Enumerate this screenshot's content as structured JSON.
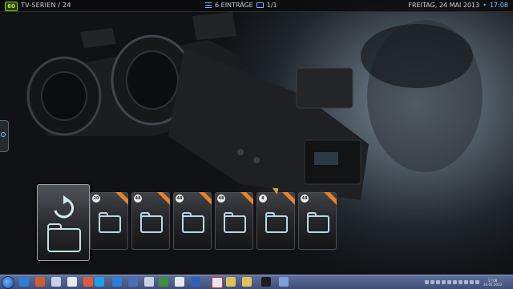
{
  "header": {
    "logo_text": "60",
    "breadcrumb": "TV-SERIEN / 24",
    "items_count": "6 EINTRÄGE",
    "page": "1/1",
    "date": "FREITAG, 24 MAI 2013",
    "separator": "•",
    "time": "17:08"
  },
  "tiles": [
    {
      "badge": "20",
      "ribbon": true
    },
    {
      "badge": "48",
      "ribbon": true
    },
    {
      "badge": "48",
      "ribbon": true
    },
    {
      "badge": "48",
      "ribbon": true
    },
    {
      "badge": "8",
      "ribbon": true
    },
    {
      "badge": "48",
      "ribbon": true
    }
  ],
  "selected_tile": {
    "icon": "back-arrow-icon"
  },
  "taskbar": {
    "clock_time": "17:08",
    "clock_date": "24.05.2013",
    "icons": [
      "ie-icon",
      "media-icon",
      "paint-icon",
      "skype-icon",
      "ie-icon",
      "xbmc-icon",
      "game-icon",
      "word-icon",
      "image-icon",
      "excel-icon",
      "settings-icon",
      "folder-icon",
      "folder-icon",
      "app-icon",
      "media-icon"
    ]
  },
  "colors": {
    "accent": "#8fc3ff",
    "logo": "#8fd01a",
    "ribbon": "#e8832a"
  }
}
